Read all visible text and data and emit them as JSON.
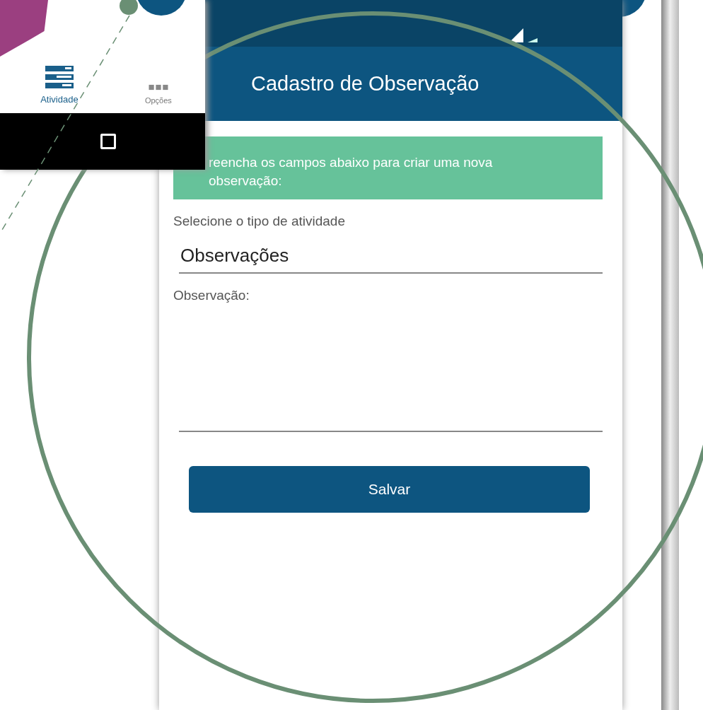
{
  "left_screen": {
    "nav_items": [
      {
        "label": "Atividade",
        "kind": "list",
        "selected": true
      },
      {
        "label": "Opções",
        "kind": "more",
        "selected": false
      }
    ]
  },
  "screen": {
    "title": "Cadastro de Observação",
    "banner": "reencha os campos abaixo para criar uma nova observação:",
    "activity_label": "Selecione o tipo de atividade",
    "activity_value": "Observações",
    "observation_label": "Observação:",
    "save_button": "Salvar"
  }
}
